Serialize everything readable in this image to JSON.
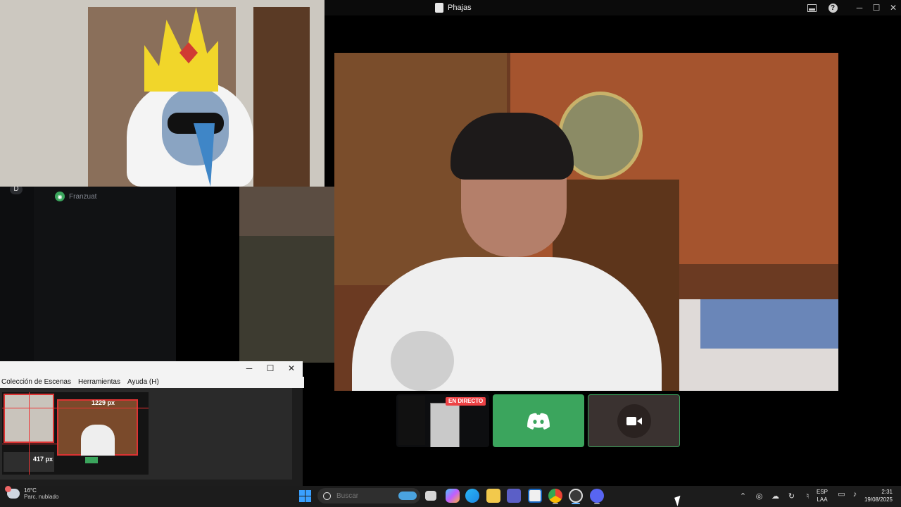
{
  "window": {
    "title": "Phajas",
    "controls": {
      "minimize": "─",
      "maximize": "☐",
      "close": "✕"
    }
  },
  "side_panel": {
    "badge": "D",
    "member_name": "Franzuat"
  },
  "tiles": {
    "live_badge": "EN DIRECTO"
  },
  "obs": {
    "controls": {
      "minimize": "─",
      "maximize": "☐",
      "close": "✕"
    },
    "menu": [
      "Colección de Escenas",
      "Herramientas",
      "Ayuda (H)"
    ],
    "width_label": "1229 px",
    "height_label": "417 px"
  },
  "taskbar": {
    "weather_temp": "16°C",
    "weather_desc": "Parc. nublado",
    "search_placeholder": "Buscar",
    "lang_line1": "ESP",
    "lang_line2": "LAA",
    "time": "2:31",
    "date": "19/08/2025",
    "apps": [
      "task-view",
      "copilot",
      "edge",
      "file-explorer",
      "teams",
      "vscode",
      "chrome",
      "obs",
      "discord"
    ]
  },
  "colors": {
    "discord_green": "#3ba55d",
    "live_red": "#ed4245",
    "discord_blurple": "#5865f2"
  }
}
